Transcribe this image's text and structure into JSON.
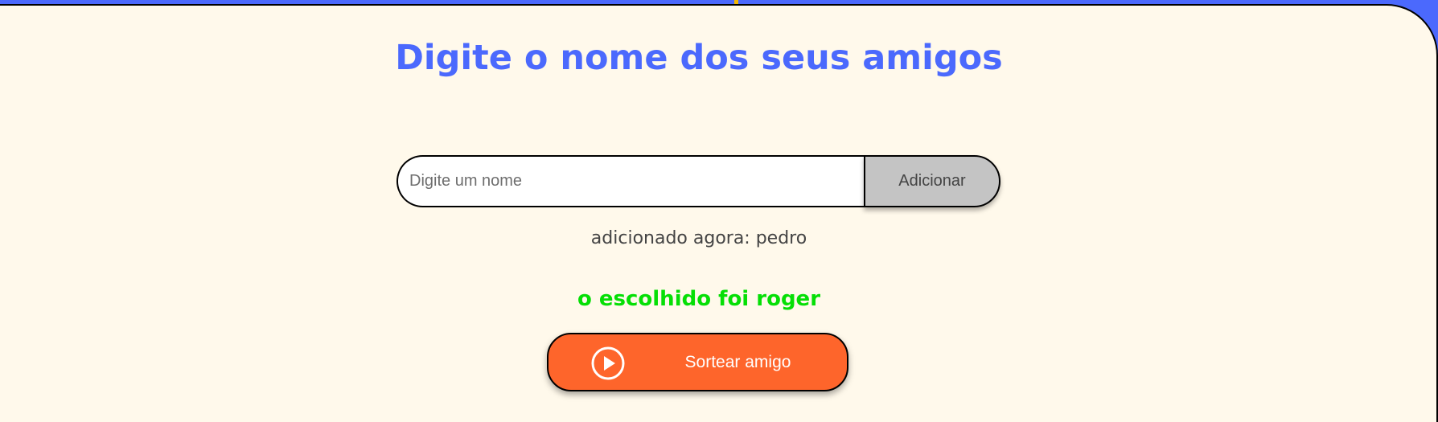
{
  "title": "Digite o nome dos seus amigos",
  "form": {
    "placeholder": "Digite um nome",
    "value": "",
    "add_label": "Adicionar"
  },
  "status": {
    "added_text": "adicionado agora: pedro",
    "result_text": "o escolhido foi roger"
  },
  "draw_button": {
    "label": "Sortear amigo",
    "icon": "play-circle-icon"
  },
  "colors": {
    "background": "#4B69FD",
    "panel": "#FFF9EB",
    "title": "#4B69FD",
    "result": "#05DF05",
    "draw_button": "#FE652B",
    "add_button": "#C4C4C4"
  }
}
